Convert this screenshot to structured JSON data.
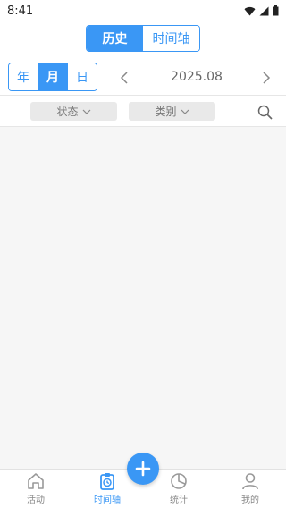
{
  "status_bar": {
    "time": "8:41"
  },
  "header": {
    "tabs": [
      {
        "label": "历史",
        "active": true
      },
      {
        "label": "时间轴",
        "active": false
      }
    ]
  },
  "period": {
    "options": [
      {
        "label": "年",
        "active": false
      },
      {
        "label": "月",
        "active": true
      },
      {
        "label": "日",
        "active": false
      }
    ],
    "current": "2025.08"
  },
  "filters": {
    "status_label": "状态",
    "type_label": "类别"
  },
  "bottom_nav": {
    "items": [
      {
        "label": "活动",
        "icon": "home-icon",
        "active": false
      },
      {
        "label": "时间轴",
        "icon": "clipboard-clock-icon",
        "active": true
      },
      {
        "label": "统计",
        "icon": "pie-chart-icon",
        "active": false
      },
      {
        "label": "我的",
        "icon": "user-icon",
        "active": false
      }
    ]
  },
  "colors": {
    "accent": "#3a97f5",
    "content_bg": "#f6f6f6"
  }
}
